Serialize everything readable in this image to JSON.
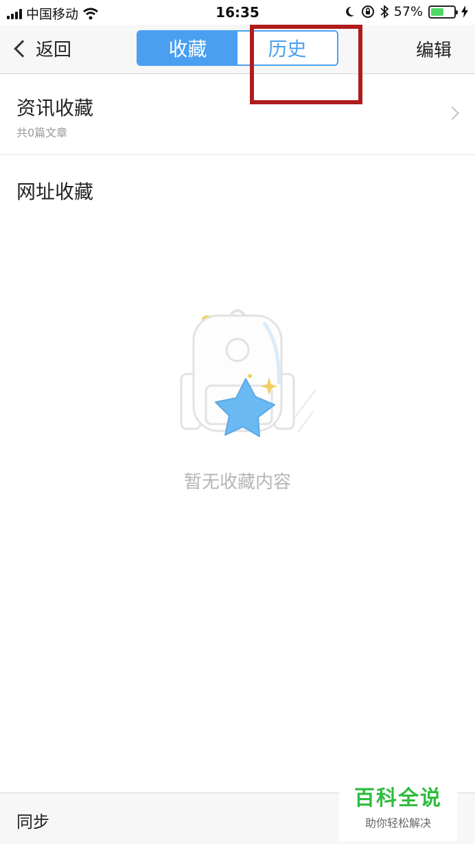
{
  "status_bar": {
    "carrier": "中国移动",
    "time": "16:35",
    "battery_percent": "57%",
    "battery_level": 0.57,
    "icons": [
      "signal-icon",
      "wifi-icon",
      "moon-icon",
      "rotation-lock-icon",
      "bluetooth-icon",
      "battery-icon",
      "charging-icon"
    ]
  },
  "nav": {
    "back_label": "返回",
    "tabs": [
      {
        "label": "收藏",
        "active": true
      },
      {
        "label": "历史",
        "active": false
      }
    ],
    "edit_label": "编辑"
  },
  "list": {
    "items": [
      {
        "title": "资讯收藏",
        "subtitle": "共0篇文章"
      },
      {
        "title": "网址收藏"
      }
    ]
  },
  "empty_state": {
    "text": "暂无收藏内容"
  },
  "bottom_bar": {
    "sync_label": "同步"
  },
  "watermark": {
    "main": "百科全说",
    "sub": "助你轻松解决"
  },
  "colors": {
    "accent": "#4a9ff0",
    "highlight": "#b01c1c",
    "watermark_green": "#2ebd3c"
  }
}
